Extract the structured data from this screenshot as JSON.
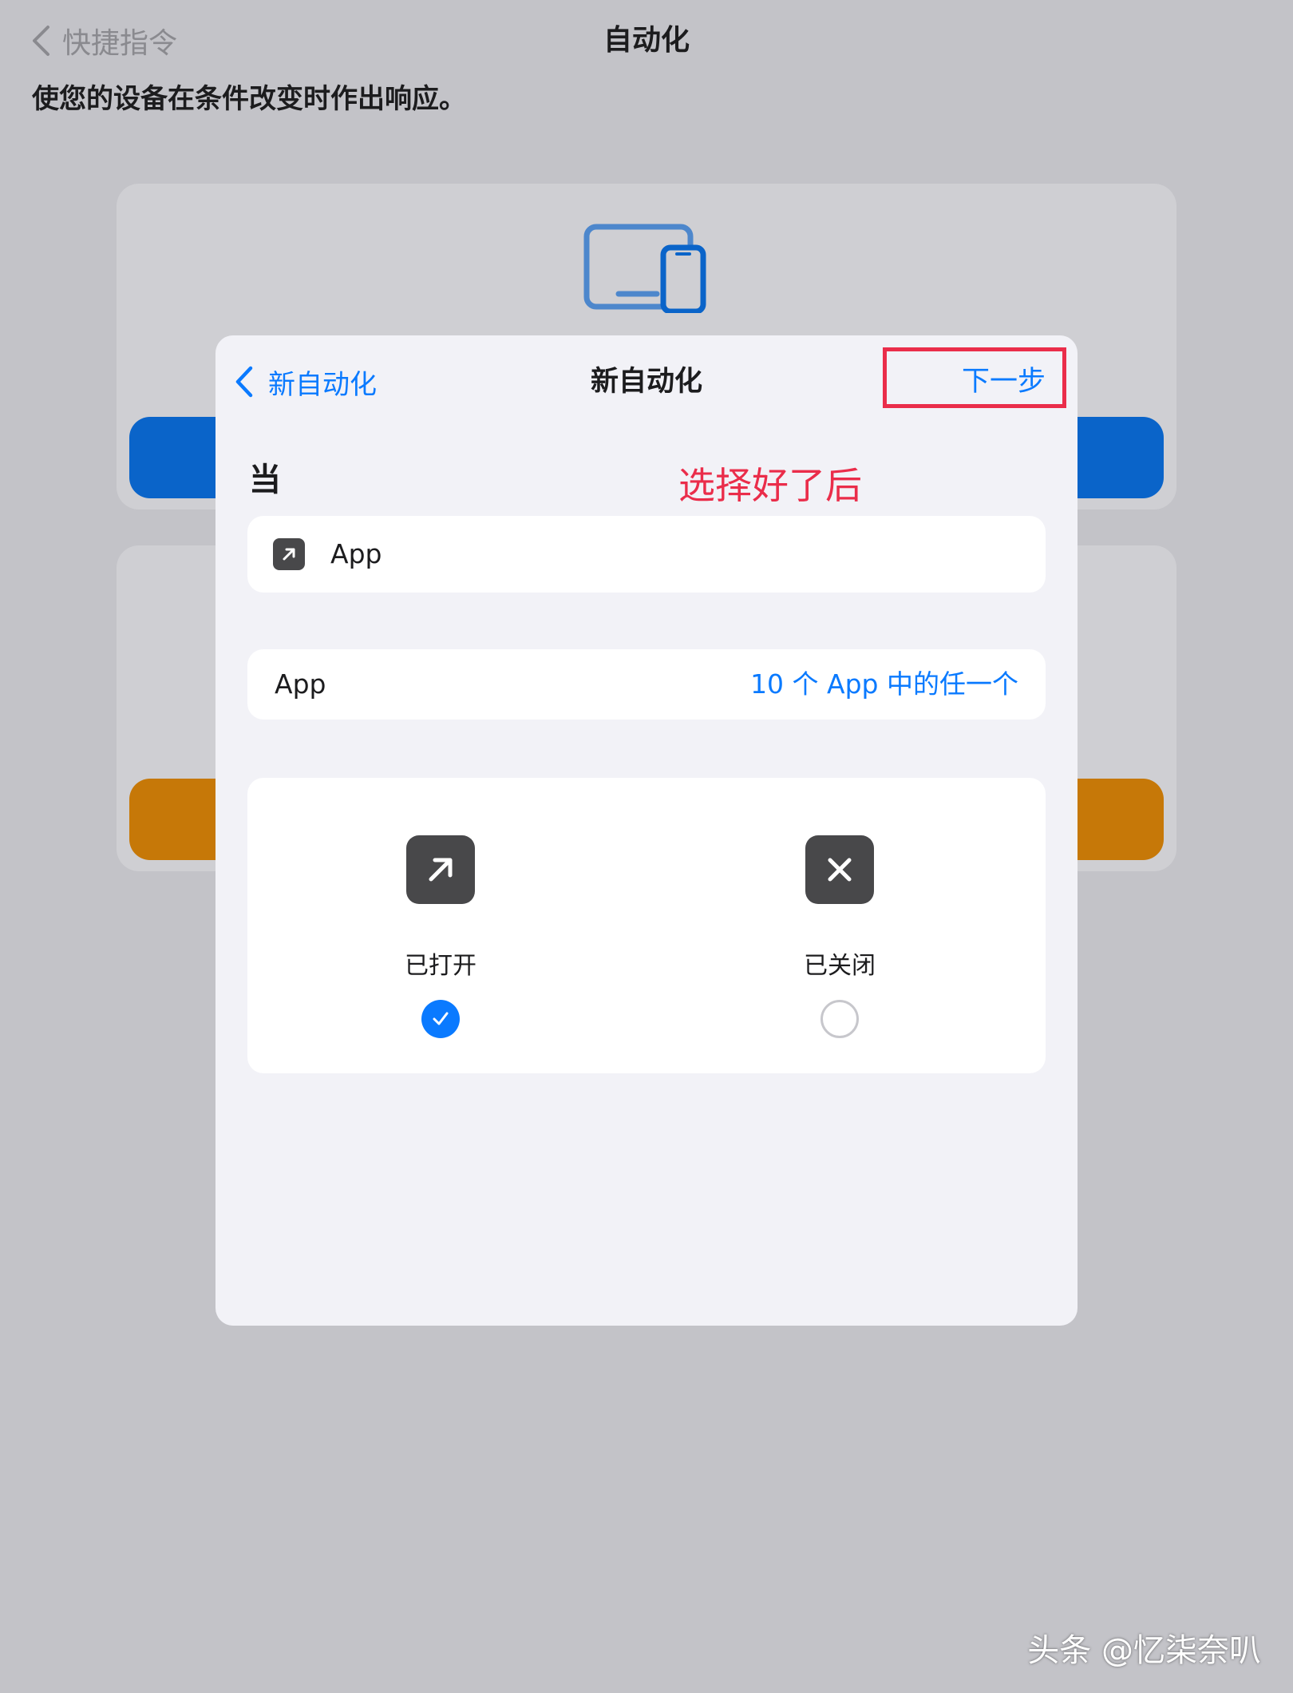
{
  "background": {
    "back_label": "快捷指令",
    "title": "自动化",
    "subtitle": "使您的设备在条件改变时作出响应。"
  },
  "sheet": {
    "back_label": "新自动化",
    "title": "新自动化",
    "next_label": "下一步",
    "section_label": "当",
    "annotation": "选择好了后",
    "trigger_row": {
      "icon": "arrow-up-right-icon",
      "label": "App"
    },
    "apps_row": {
      "label": "App",
      "value": "10 个 App 中的任一个"
    },
    "choices": [
      {
        "icon": "arrow-up-right-icon",
        "label": "已打开",
        "checked": true
      },
      {
        "icon": "close-icon",
        "label": "已关闭",
        "checked": false
      }
    ]
  },
  "watermark": "头条 @忆柒奈叭",
  "colors": {
    "accent": "#0a7aff",
    "annotation": "#ea2d4a",
    "blue_button": "#0a64c9",
    "orange_button": "#c67808"
  }
}
